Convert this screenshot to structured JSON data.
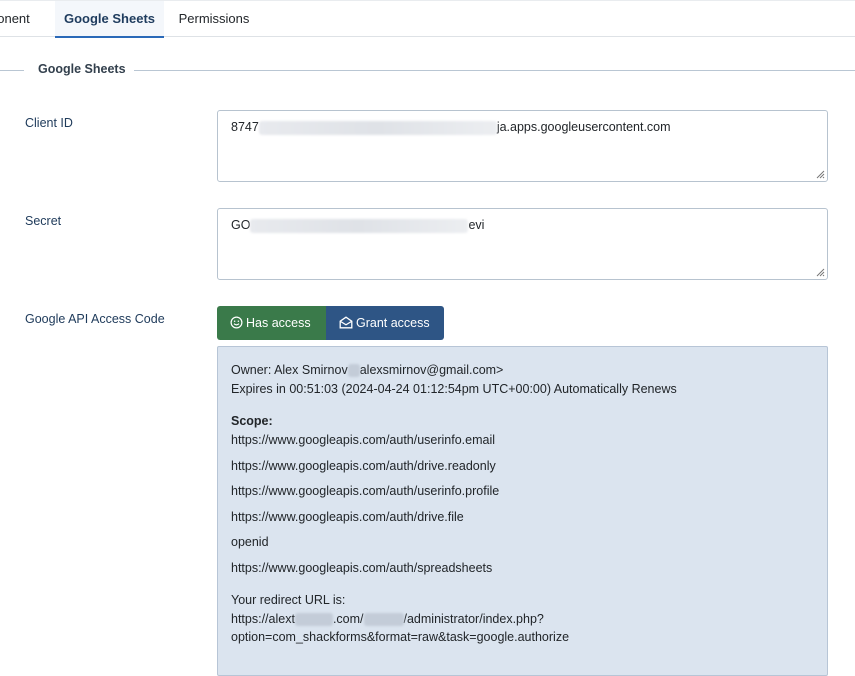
{
  "tabs": {
    "component": "ponent",
    "sheets": "Google Sheets",
    "permissions": "Permissions"
  },
  "fieldset": {
    "legend": "Google Sheets"
  },
  "fields": {
    "client_id": {
      "label": "Client ID",
      "value_prefix": "8747",
      "value_suffix": "ja.apps.googleusercontent.com"
    },
    "secret": {
      "label": "Secret",
      "value_prefix": "GO",
      "value_suffix": "evi"
    },
    "access_code": {
      "label": "Google API Access Code"
    }
  },
  "buttons": {
    "has_access": "Has access",
    "grant_access": "Grant access"
  },
  "info": {
    "owner_prefix": "Owner: Alex Smirnov",
    "owner_suffix": "alexsmirnov@gmail.com>",
    "expires": "Expires in 00:51:03 (2024-04-24 01:12:54pm UTC+00:00) Automatically Renews",
    "scope_label": "Scope:",
    "scopes": [
      "https://www.googleapis.com/auth/userinfo.email",
      "https://www.googleapis.com/auth/drive.readonly",
      "https://www.googleapis.com/auth/userinfo.profile",
      "https://www.googleapis.com/auth/drive.file",
      "openid",
      "https://www.googleapis.com/auth/spreadsheets"
    ],
    "redirect_label": "Your redirect URL is:",
    "redirect_part1": "https://alext",
    "redirect_part2": ".com/",
    "redirect_part3": "/administrator/index.php?",
    "redirect_line2": "option=com_shackforms&format=raw&task=google.authorize"
  },
  "colors": {
    "accent": "#2a69b8",
    "success_button": "#3a7a4a",
    "primary_button": "#2e5585",
    "info_background": "#dbe4ef"
  },
  "icons": {
    "has_access": "smile-icon",
    "grant_access": "envelope-open-icon",
    "resize": "resize-grip-icon"
  }
}
